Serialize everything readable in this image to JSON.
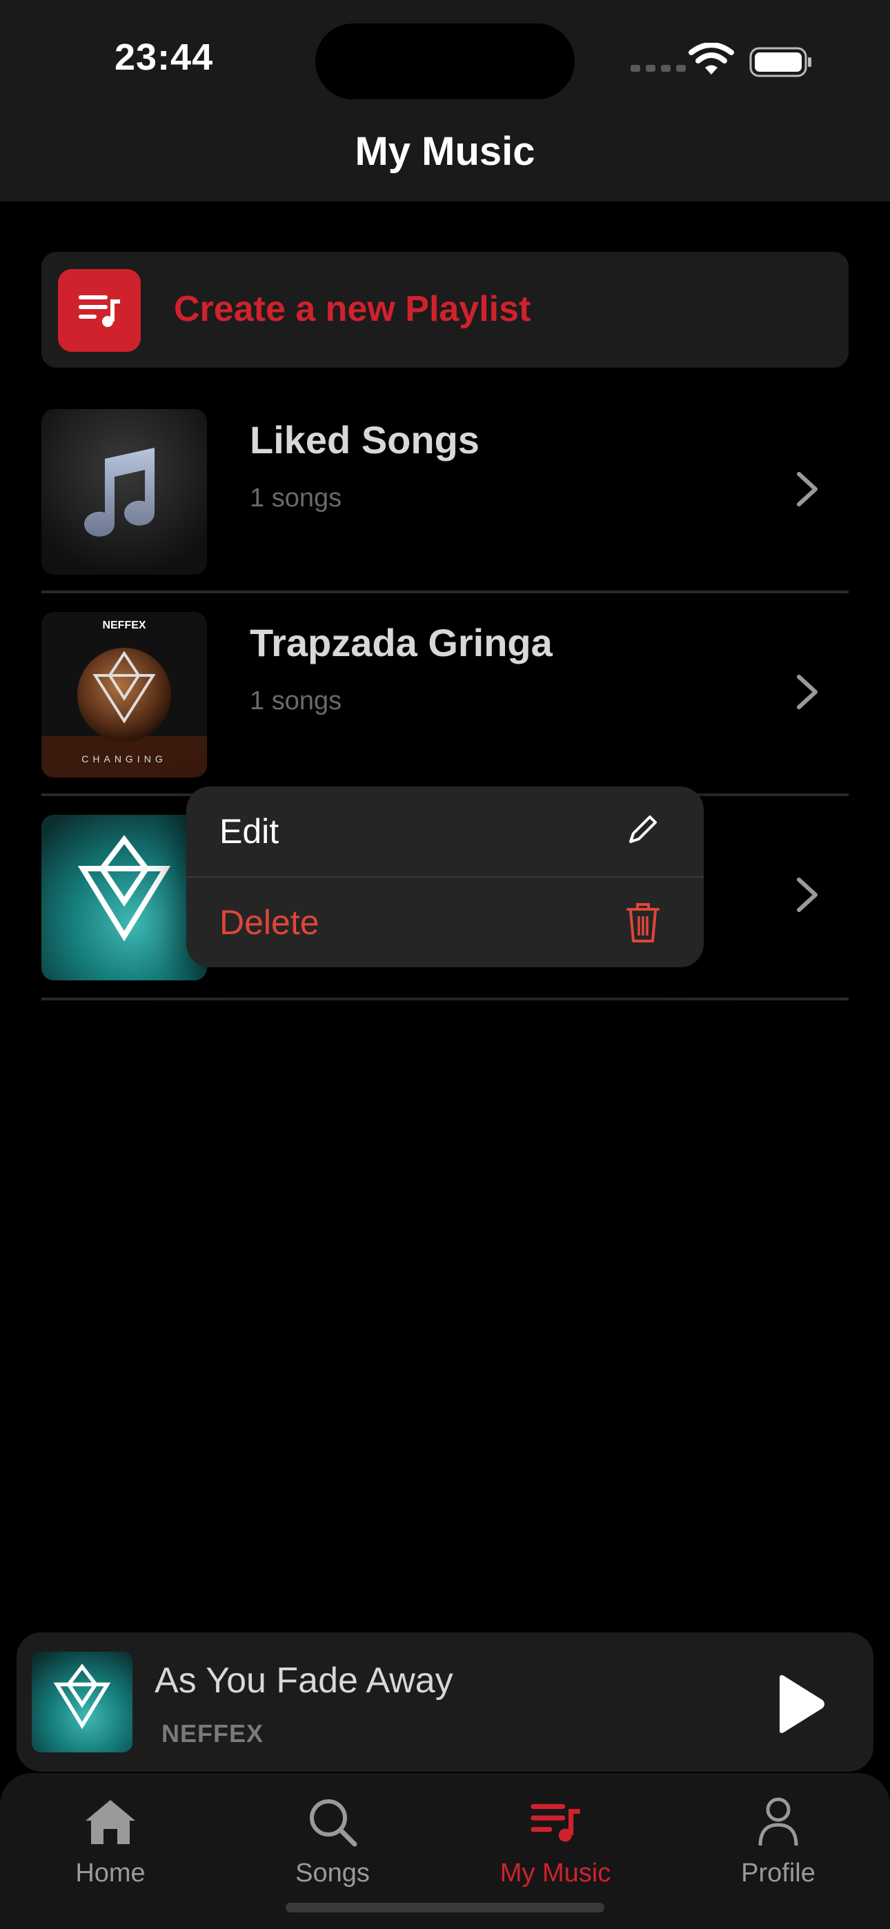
{
  "status_bar": {
    "time": "23:44"
  },
  "header": {
    "title": "My Music"
  },
  "create_playlist": {
    "label": "Create a new Playlist"
  },
  "playlists": [
    {
      "name": "Liked Songs",
      "count": "1 songs",
      "art": "music-note-icon"
    },
    {
      "name": "Trapzada Gringa",
      "count": "1 songs",
      "art": "album-changing",
      "art_brand": "NEFFEX",
      "art_text": "CHANGING"
    },
    {
      "name": "",
      "count": "",
      "art": "album-you-fade-away"
    }
  ],
  "context_menu": {
    "edit_label": "Edit",
    "delete_label": "Delete"
  },
  "player": {
    "title": "As You Fade Away",
    "artist": "NEFFEX"
  },
  "tabs": [
    {
      "label": "Home",
      "icon": "house-icon",
      "active": false
    },
    {
      "label": "Songs",
      "icon": "search-icon",
      "active": false
    },
    {
      "label": "My Music",
      "icon": "playlist-icon",
      "active": true
    },
    {
      "label": "Profile",
      "icon": "person-icon",
      "active": false
    }
  ],
  "colors": {
    "accent": "#d0222d",
    "delete": "#e0453a",
    "background": "#000000"
  }
}
